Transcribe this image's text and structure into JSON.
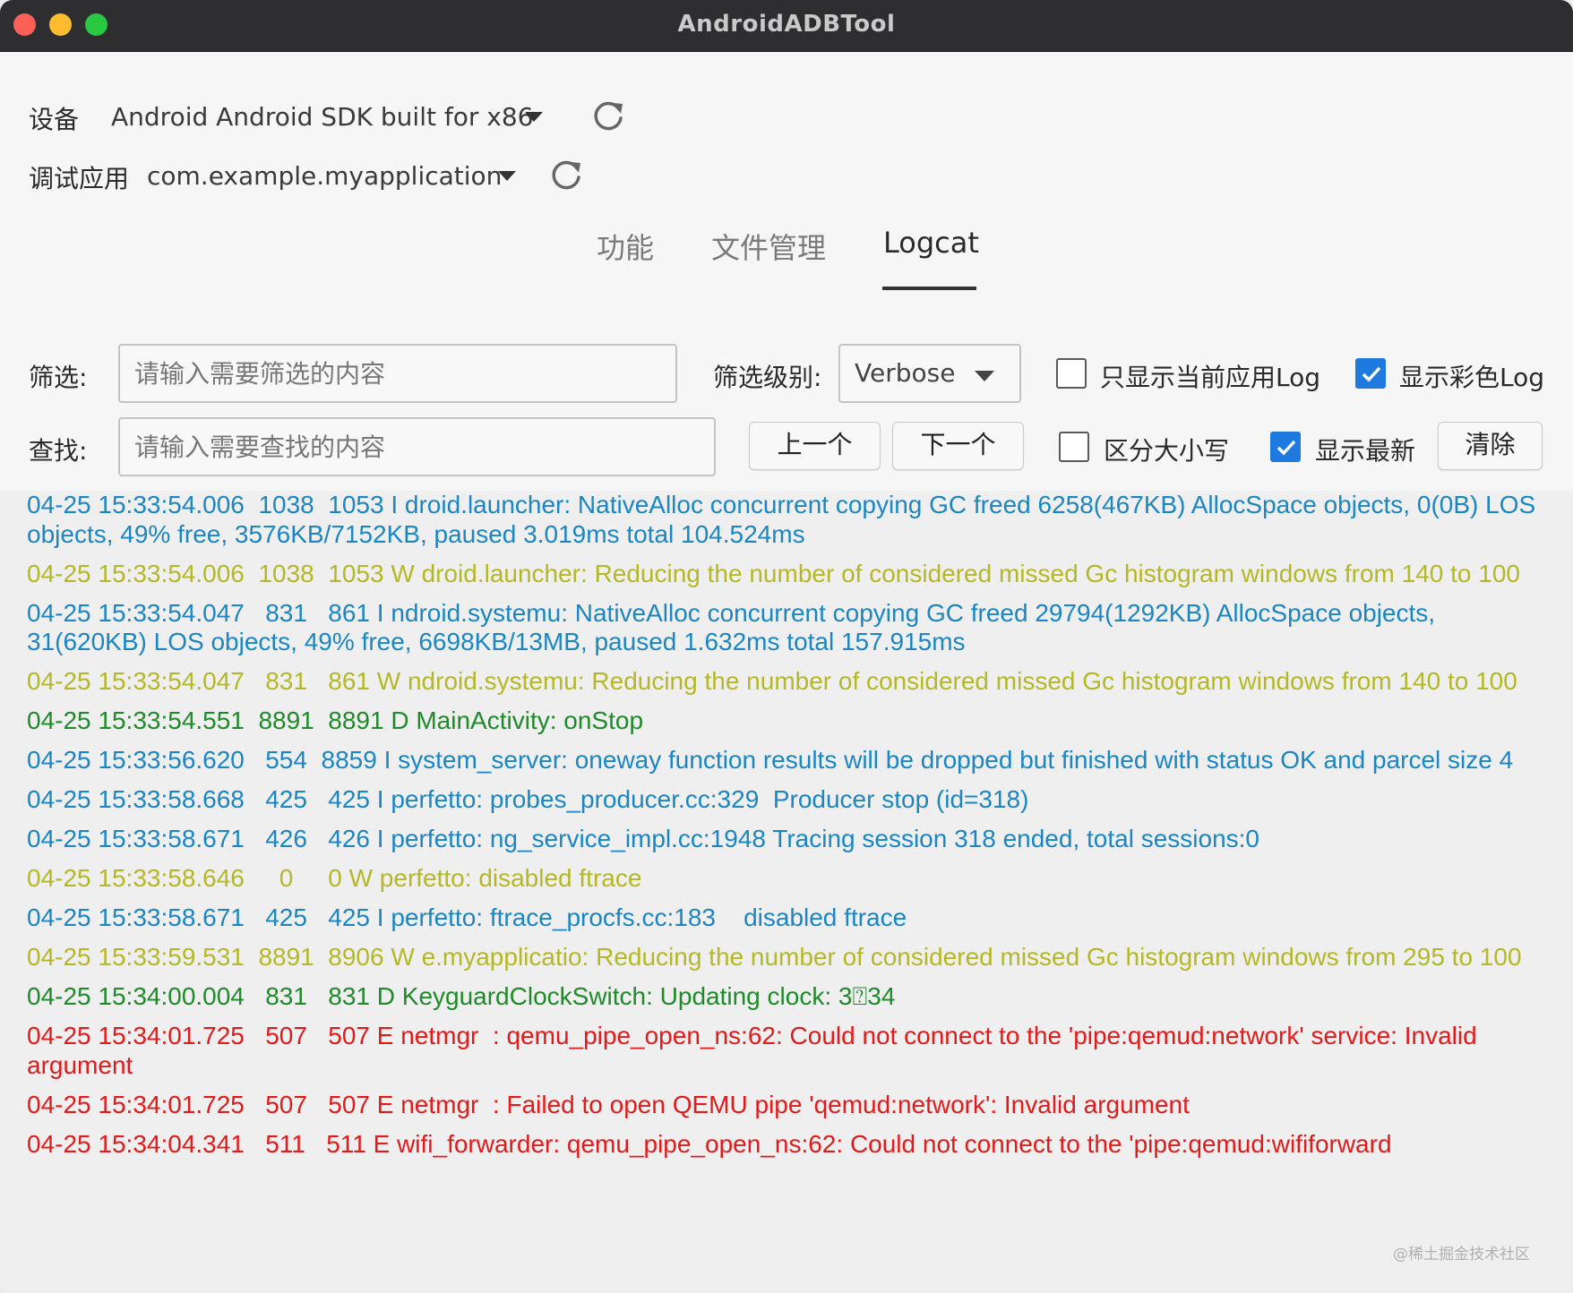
{
  "window": {
    "title": "AndroidADBTool"
  },
  "device": {
    "label": "设备",
    "value": "Android Android SDK built for x86"
  },
  "app": {
    "label": "调试应用",
    "value": "com.example.myapplication"
  },
  "tabs": [
    {
      "label": "功能",
      "active": false
    },
    {
      "label": "文件管理",
      "active": false
    },
    {
      "label": "Logcat",
      "active": true
    }
  ],
  "filter": {
    "label": "筛选:",
    "placeholder": "请输入需要筛选的内容",
    "value": ""
  },
  "level": {
    "label": "筛选级别:",
    "value": "Verbose"
  },
  "options": {
    "only_current_app": {
      "label": "只显示当前应用Log",
      "checked": false
    },
    "color_log": {
      "label": "显示彩色Log",
      "checked": true
    },
    "case_sensitive": {
      "label": "区分大小写",
      "checked": false
    },
    "show_latest": {
      "label": "显示最新",
      "checked": true
    }
  },
  "search": {
    "label": "查找:",
    "placeholder": "请输入需要查找的内容",
    "value": ""
  },
  "buttons": {
    "prev": "上一个",
    "next": "下一个",
    "clear": "清除"
  },
  "colors": {
    "info": "#1b86c2",
    "warn": "#b5b826",
    "debug": "#1f8a2a",
    "error": "#e01b1b",
    "check": "#1f7ae0"
  },
  "logs": [
    {
      "level": "I",
      "text": "04-25 15:33:54.006  1038  1053 I droid.launcher: NativeAlloc concurrent copying GC freed 6258(467KB) AllocSpace objects, 0(0B) LOS objects, 49% free, 3576KB/7152KB, paused 3.019ms total 104.524ms"
    },
    {
      "level": "W",
      "text": "04-25 15:33:54.006  1038  1053 W droid.launcher: Reducing the number of considered missed Gc histogram windows from 140 to 100"
    },
    {
      "level": "I",
      "text": "04-25 15:33:54.047   831   861 I ndroid.systemu: NativeAlloc concurrent copying GC freed 29794(1292KB) AllocSpace objects, 31(620KB) LOS objects, 49% free, 6698KB/13MB, paused 1.632ms total 157.915ms"
    },
    {
      "level": "W",
      "text": "04-25 15:33:54.047   831   861 W ndroid.systemu: Reducing the number of considered missed Gc histogram windows from 140 to 100"
    },
    {
      "level": "D",
      "text": "04-25 15:33:54.551  8891  8891 D MainActivity: onStop"
    },
    {
      "level": "I",
      "text": "04-25 15:33:56.620   554  8859 I system_server: oneway function results will be dropped but finished with status OK and parcel size 4"
    },
    {
      "level": "I",
      "text": "04-25 15:33:58.668   425   425 I perfetto: probes_producer.cc:329  Producer stop (id=318)"
    },
    {
      "level": "I",
      "text": "04-25 15:33:58.671   426   426 I perfetto: ng_service_impl.cc:1948 Tracing session 318 ended, total sessions:0"
    },
    {
      "level": "W",
      "text": "04-25 15:33:58.646     0     0 W perfetto: disabled ftrace"
    },
    {
      "level": "I",
      "text": "04-25 15:33:58.671   425   425 I perfetto: ftrace_procfs.cc:183    disabled ftrace"
    },
    {
      "level": "W",
      "text": "04-25 15:33:59.531  8891  8906 W e.myapplicatio: Reducing the number of considered missed Gc histogram windows from 295 to 100"
    },
    {
      "level": "D",
      "text": "04-25 15:34:00.004   831   831 D KeyguardClockSwitch: Updating clock: 3⍰34"
    },
    {
      "level": "E",
      "text": "04-25 15:34:01.725   507   507 E netmgr  : qemu_pipe_open_ns:62: Could not connect to the 'pipe:qemud:network' service: Invalid argument"
    },
    {
      "level": "E",
      "text": "04-25 15:34:01.725   507   507 E netmgr  : Failed to open QEMU pipe 'qemud:network': Invalid argument"
    },
    {
      "level": "E",
      "text": "04-25 15:34:04.341   511   511 E wifi_forwarder: qemu_pipe_open_ns:62: Could not connect to the 'pipe:qemud:wififorward"
    }
  ],
  "watermark": "@稀土掘金技术社区"
}
